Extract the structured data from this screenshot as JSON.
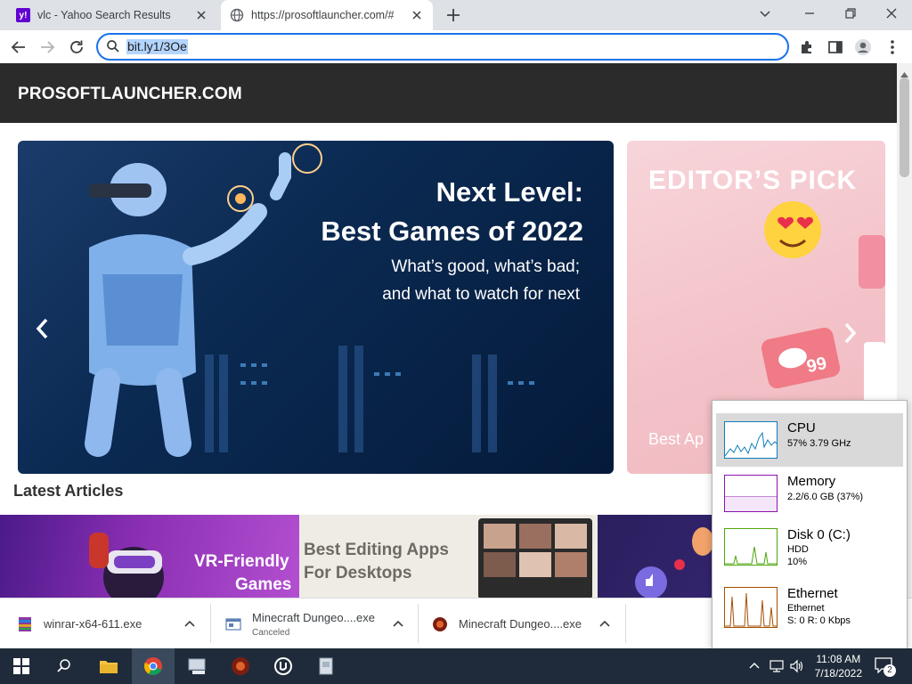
{
  "browser": {
    "tabs": [
      {
        "title": "vlc - Yahoo Search Results",
        "favicon": "yahoo-icon"
      },
      {
        "title": "https://prosoftlauncher.com/#",
        "favicon": "globe-icon"
      }
    ],
    "new_tab": "+",
    "address": "bit.ly1/3Oe"
  },
  "page": {
    "site_name": "PROSOFTLAUNCHER.COM",
    "hero": {
      "title_line1": "Next Level:",
      "title_line2": "Best Games of 2022",
      "subtitle_line1": "What’s good, what’s bad;",
      "subtitle_line2": "and what to watch for next"
    },
    "editors_pick": {
      "title": "EDITOR’S PICK",
      "bottom_text": "Best Ap",
      "badge": "99"
    },
    "latest_heading": "Latest Articles",
    "articles": [
      {
        "line1": "VR-Friendly",
        "line2": "Games"
      },
      {
        "line1": "Best Editing Apps",
        "line2": "For Desktops"
      }
    ]
  },
  "downloads": [
    {
      "name": "winrar-x64-611.exe",
      "status": ""
    },
    {
      "name": "Minecraft Dungeo....exe",
      "status": "Canceled"
    },
    {
      "name": "Minecraft Dungeo....exe",
      "status": ""
    }
  ],
  "task_manager": [
    {
      "name": "CPU",
      "line1": "57%  3.79 GHz",
      "line2": "",
      "color": "#117dbb"
    },
    {
      "name": "Memory",
      "line1": "2.2/6.0 GB (37%)",
      "line2": "",
      "color": "#8b12ae"
    },
    {
      "name": "Disk 0 (C:)",
      "line1": "HDD",
      "line2": "10%",
      "color": "#4da60c"
    },
    {
      "name": "Ethernet",
      "line1": "Ethernet",
      "line2": "S: 0  R: 0 Kbps",
      "color": "#a74f01"
    }
  ],
  "taskbar": {
    "time": "11:08 AM",
    "date": "7/18/2022",
    "notification_count": "2"
  }
}
